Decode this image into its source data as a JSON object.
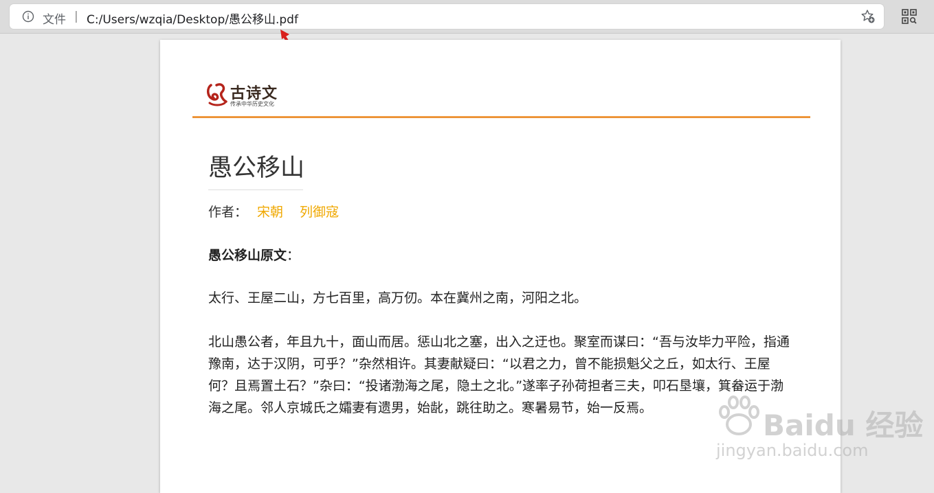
{
  "address_bar": {
    "scheme_label": "文件",
    "separator": "|",
    "url": "C:/Users/wzqia/Desktop/愚公移山.pdf"
  },
  "icons": {
    "info": "info-icon",
    "favorite": "star-plus-icon",
    "qr": "qr-code-icon",
    "annotation": "red-arrow-icon"
  },
  "document": {
    "logo": {
      "title": "古诗文",
      "subtitle": "传承中华历史文化"
    },
    "title": "愚公移山",
    "author_label": "作者：",
    "author_dynasty": "宋朝",
    "author_name": "列御寇",
    "section_heading": "愚公移山原文",
    "section_heading_suffix": "：",
    "paragraphs": [
      "太行、王屋二山，方七百里，高万仞。本在冀州之南，河阳之北。",
      "北山愚公者，年且九十，面山而居。惩山北之塞，出入之迂也。聚室而谋曰：“吾与汝毕力平险，指通豫南，达于汉阴，可乎？”杂然相许。其妻献疑曰：“以君之力，曾不能损魁父之丘，如太行、王屋何？且焉置土石？”杂曰：“投诸渤海之尾，隐土之北。”遂率子孙荷担者三夫，叩石垦壤，箕畚运于渤海之尾。邻人京城氏之孀妻有遗男，始龀，跳往助之。寒暑易节，始一反焉。"
    ]
  },
  "watermark": {
    "main": "Baidu 经验",
    "sub": "jingyan.baidu.com"
  },
  "colors": {
    "accent_orange": "#e8892a",
    "author_link": "#f0a800",
    "arrow_red": "#d9201c"
  }
}
